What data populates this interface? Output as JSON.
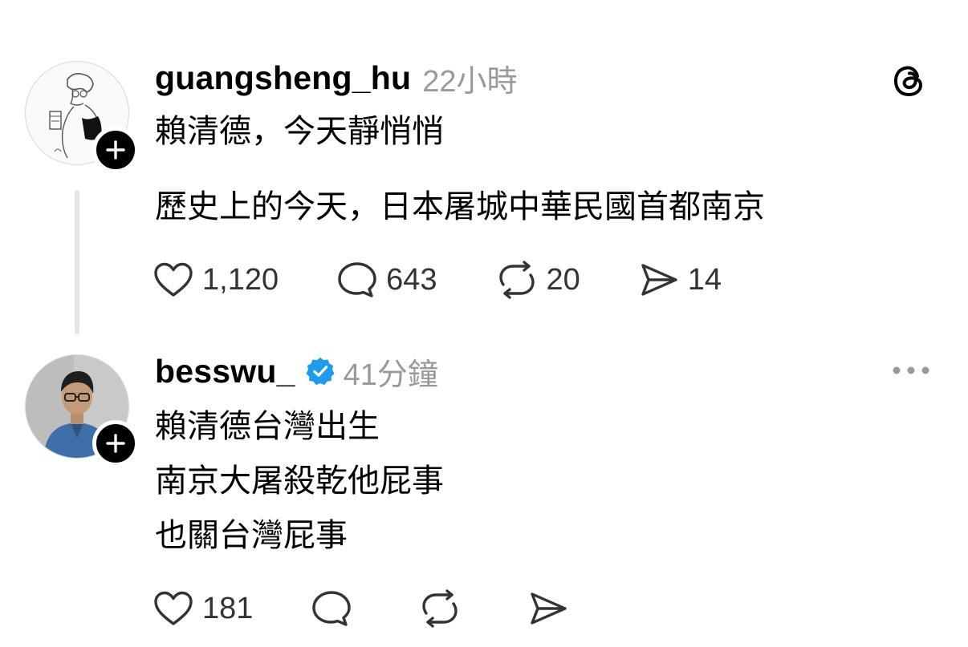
{
  "posts": [
    {
      "username": "guangsheng_hu",
      "timestamp": "22小時",
      "verified": false,
      "paragraphs": [
        "賴清德，今天靜悄悄",
        "歷史上的今天，日本屠城中華民國首都南京"
      ],
      "actions": {
        "like_count": "1,120",
        "reply_count": "643",
        "repost_count": "20",
        "share_count": "14"
      },
      "corner_icon": "threads-logo-icon"
    },
    {
      "username": "besswu_",
      "timestamp": "41分鐘",
      "verified": true,
      "lines": [
        "賴清德台灣出生",
        "南京大屠殺乾他屁事",
        "也關台灣屁事"
      ],
      "actions": {
        "like_count": "181",
        "reply_count": "",
        "repost_count": "",
        "share_count": ""
      },
      "corner_icon": "more-options-icon"
    }
  ],
  "colors": {
    "text": "#000000",
    "muted": "#9a9a9a",
    "verified": "#1d9bf0",
    "thread_line": "#e4e4e4"
  }
}
